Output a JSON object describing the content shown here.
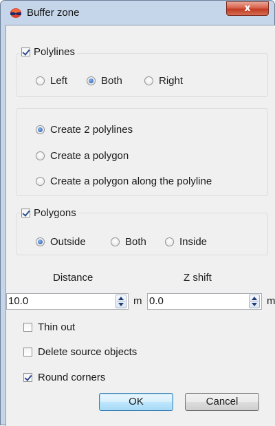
{
  "window": {
    "title": "Buffer zone",
    "close_glyph": "x"
  },
  "polylines_group": {
    "legend": "Polylines",
    "checked": true,
    "options": [
      "Left",
      "Both",
      "Right"
    ],
    "selected": "Both"
  },
  "mode_group": {
    "options": [
      "Create 2 polylines",
      "Create a polygon",
      "Create a polygon along the polyline"
    ],
    "selected": "Create 2 polylines"
  },
  "polygons_group": {
    "legend": "Polygons",
    "checked": true,
    "options": [
      "Outside",
      "Both",
      "Inside"
    ],
    "selected": "Outside"
  },
  "distance": {
    "label": "Distance",
    "value": "10.0",
    "unit": "m"
  },
  "z_shift": {
    "label": "Z shift",
    "value": "0.0",
    "unit": "m"
  },
  "checkboxes": {
    "thin_out": {
      "label": "Thin out",
      "checked": false
    },
    "delete_source": {
      "label": "Delete source objects",
      "checked": false
    },
    "round_corners": {
      "label": "Round corners",
      "checked": true
    }
  },
  "buttons": {
    "ok": "OK",
    "cancel": "Cancel"
  }
}
